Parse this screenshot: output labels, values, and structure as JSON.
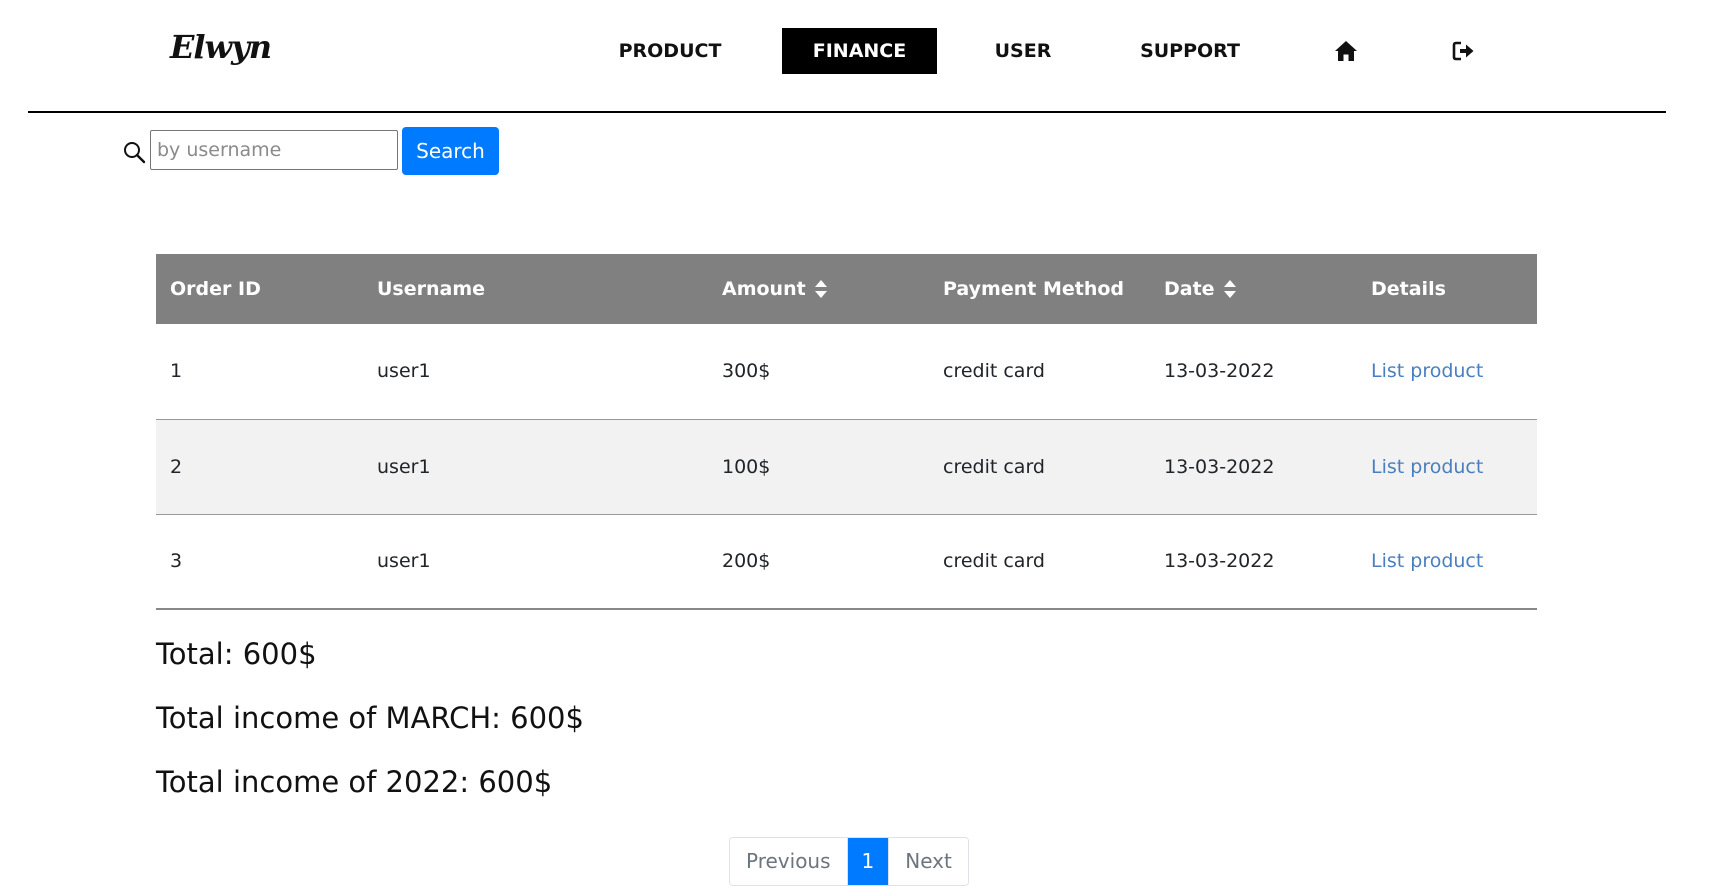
{
  "brand": {
    "logo_text": "Elwyn"
  },
  "nav": {
    "items": [
      {
        "label": "PRODUCT",
        "active": false
      },
      {
        "label": "FINANCE",
        "active": true
      },
      {
        "label": "USER",
        "active": false
      },
      {
        "label": "SUPPORT",
        "active": false
      }
    ],
    "icons": [
      "home-icon",
      "logout-icon"
    ]
  },
  "search": {
    "icon": "search-icon",
    "placeholder": "by username",
    "value": "",
    "button_label": "Search"
  },
  "table": {
    "columns": [
      {
        "label": "Order ID",
        "sortable": false
      },
      {
        "label": "Username",
        "sortable": false
      },
      {
        "label": "Amount",
        "sortable": true
      },
      {
        "label": "Payment Method",
        "sortable": false
      },
      {
        "label": "Date",
        "sortable": true
      },
      {
        "label": "Details",
        "sortable": false
      }
    ],
    "rows": [
      {
        "order_id": "1",
        "username": "user1",
        "amount": "300$",
        "payment_method": "credit card",
        "date": "13-03-2022",
        "details": "List product"
      },
      {
        "order_id": "2",
        "username": "user1",
        "amount": "100$",
        "payment_method": "credit card",
        "date": "13-03-2022",
        "details": "List product"
      },
      {
        "order_id": "3",
        "username": "user1",
        "amount": "200$",
        "payment_method": "credit card",
        "date": "13-03-2022",
        "details": "List product"
      }
    ]
  },
  "totals": {
    "total": "Total: 600$",
    "month": "Total income of MARCH: 600$",
    "year": "Total income of 2022: 600$"
  },
  "pagination": {
    "previous": "Previous",
    "current": "1",
    "next": "Next"
  },
  "colors": {
    "primary": "#007bff",
    "header_bg": "#808080",
    "nav_active_bg": "#000000",
    "link": "#4a7fbf",
    "row_alt": "#f2f2f2"
  }
}
